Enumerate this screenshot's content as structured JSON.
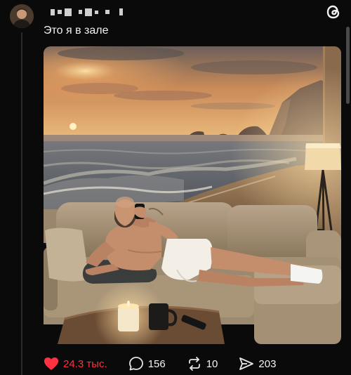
{
  "post": {
    "text": "Это я в зале"
  },
  "actions": {
    "likes": "24.3 тыс.",
    "replies": "156",
    "reposts": "10",
    "shares": "203"
  },
  "colors": {
    "background": "#0a0a0a",
    "like_red": "#ff3040",
    "text": "#f3f3f3"
  },
  "icons": {
    "app": "threads-icon",
    "like": "heart-filled-icon",
    "reply": "comment-bubble-icon",
    "repost": "repost-icon",
    "share": "send-icon"
  }
}
